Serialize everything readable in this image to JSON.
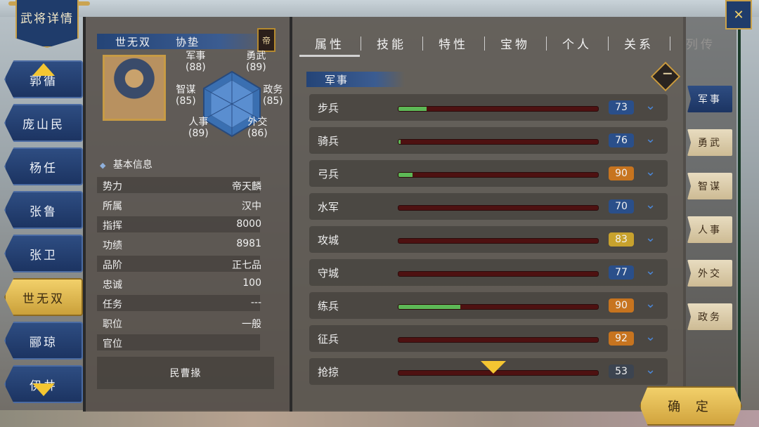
{
  "window_title": "武将详情",
  "close_icon": "close-icon",
  "generals": [
    {
      "name": "郭循",
      "active": false
    },
    {
      "name": "庞山民",
      "active": false
    },
    {
      "name": "杨任",
      "active": false
    },
    {
      "name": "张鲁",
      "active": false
    },
    {
      "name": "张卫",
      "active": false
    },
    {
      "name": "世无双",
      "active": true
    },
    {
      "name": "郦琼",
      "active": false
    },
    {
      "name": "伊井",
      "active": false
    }
  ],
  "profile": {
    "name": "世无双",
    "title": "协垫",
    "badge": "帝",
    "stats": [
      {
        "label": "军事",
        "value": "(88)"
      },
      {
        "label": "勇武",
        "value": "(89)"
      },
      {
        "label": "智谋",
        "value": "(85)"
      },
      {
        "label": "政务",
        "value": "(85)"
      },
      {
        "label": "人事",
        "value": "(89)"
      },
      {
        "label": "外交",
        "value": "(86)"
      }
    ]
  },
  "basic_info": {
    "header": "基本信息",
    "rows": [
      {
        "key": "势力",
        "value": "帝天麟"
      },
      {
        "key": "所属",
        "value": "汉中"
      },
      {
        "key": "指挥",
        "value": "8000"
      },
      {
        "key": "功绩",
        "value": "8981"
      },
      {
        "key": "品阶",
        "value": "正七品"
      },
      {
        "key": "忠诚",
        "value": "100"
      },
      {
        "key": "任务",
        "value": "---"
      },
      {
        "key": "职位",
        "value": "一般"
      },
      {
        "key": "官位",
        "value": ""
      }
    ],
    "rank": "民曹掾"
  },
  "tabs": [
    "属性",
    "技能",
    "特性",
    "宝物",
    "个人",
    "关系",
    "列传"
  ],
  "section": "军事",
  "skills": [
    {
      "name": "步兵",
      "value": "73",
      "level": 0.14,
      "badge_color": "#2a4f8a"
    },
    {
      "name": "骑兵",
      "value": "76",
      "level": 0.01,
      "badge_color": "#2a4f8a"
    },
    {
      "name": "弓兵",
      "value": "90",
      "level": 0.07,
      "badge_color": "#c7741f"
    },
    {
      "name": "水军",
      "value": "70",
      "level": 0.0,
      "badge_color": "#2a4f8a"
    },
    {
      "name": "攻城",
      "value": "83",
      "level": 0.0,
      "badge_color": "#c8a22d"
    },
    {
      "name": "守城",
      "value": "77",
      "level": 0.0,
      "badge_color": "#2a4f8a"
    },
    {
      "name": "练兵",
      "value": "90",
      "level": 0.31,
      "badge_color": "#c7741f"
    },
    {
      "name": "征兵",
      "value": "92",
      "level": 0.0,
      "badge_color": "#c7741f"
    },
    {
      "name": "抢掠",
      "value": "53",
      "level": 0.0,
      "badge_color": "#3c4450"
    }
  ],
  "categories": [
    "军事",
    "勇武",
    "智谋",
    "人事",
    "外交",
    "政务"
  ],
  "confirm": "确 定"
}
